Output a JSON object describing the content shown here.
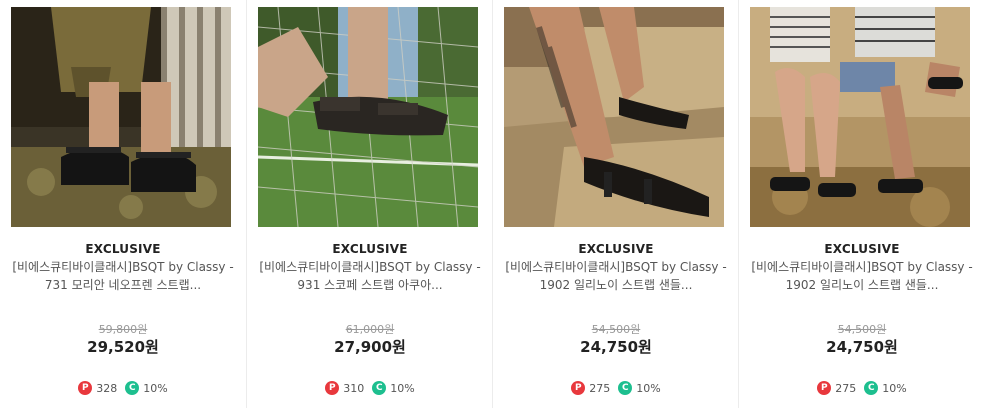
{
  "icons": {
    "points": "point-icon",
    "cashback": "cashback-icon"
  },
  "colors": {
    "points": "#e8383d",
    "cashback": "#1dbf8f"
  },
  "products": [
    {
      "badge": "EXCLUSIVE",
      "name_line1": "[비에스큐티바이클래시]BSQT by Classy -",
      "name_line2": "731 모리안 네오프렌 스트랩...",
      "original_price": "59,800원",
      "sale_price": "29,520원",
      "point_label": "P",
      "points": "328",
      "cashback_label": "C",
      "cashback": "10%"
    },
    {
      "badge": "EXCLUSIVE",
      "name_line1": "[비에스큐티바이클래시]BSQT by Classy -",
      "name_line2": "931 스코페 스트랩 아쿠아...",
      "original_price": "61,000원",
      "sale_price": "27,900원",
      "point_label": "P",
      "points": "310",
      "cashback_label": "C",
      "cashback": "10%"
    },
    {
      "badge": "EXCLUSIVE",
      "name_line1": "[비에스큐티바이클래시]BSQT by Classy -",
      "name_line2": "1902 일리노이 스트랩 샌들...",
      "original_price": "54,500원",
      "sale_price": "24,750원",
      "point_label": "P",
      "points": "275",
      "cashback_label": "C",
      "cashback": "10%"
    },
    {
      "badge": "EXCLUSIVE",
      "name_line1": "[비에스큐티바이클래시]BSQT by Classy -",
      "name_line2": "1902 일리노이 스트랩 샌들...",
      "original_price": "54,500원",
      "sale_price": "24,750원",
      "point_label": "P",
      "points": "275",
      "cashback_label": "C",
      "cashback": "10%"
    }
  ]
}
